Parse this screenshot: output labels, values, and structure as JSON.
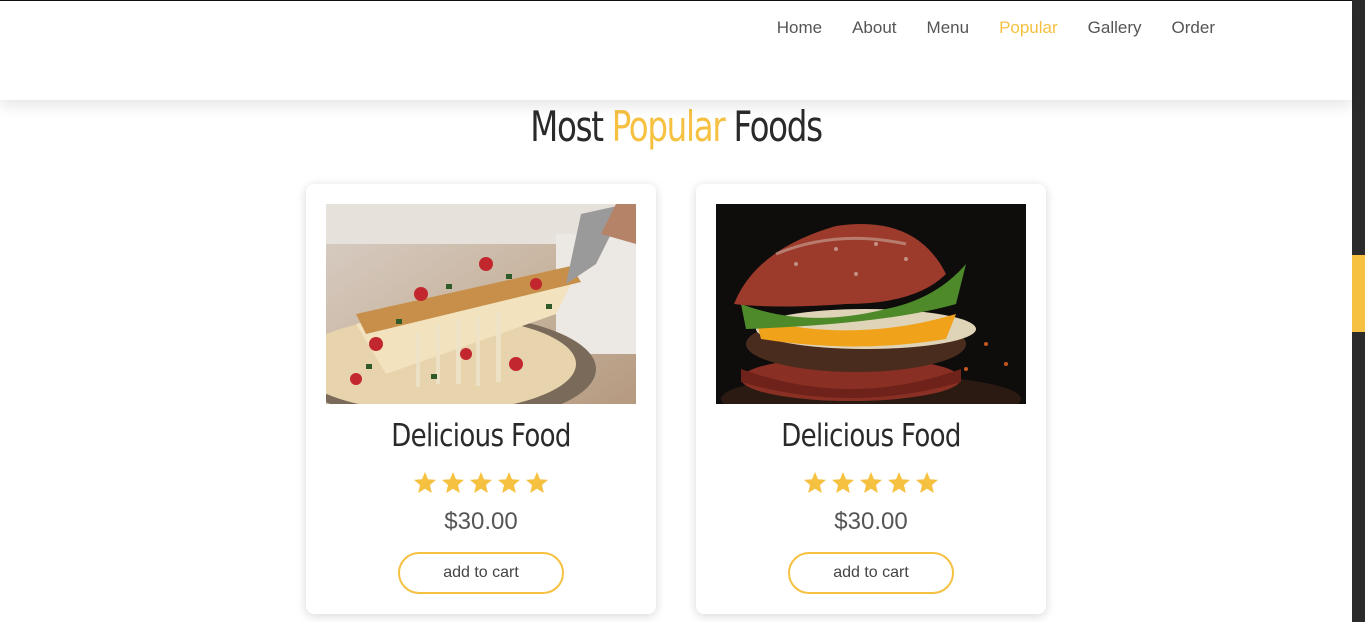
{
  "nav": {
    "items": [
      {
        "label": "Home"
      },
      {
        "label": "About"
      },
      {
        "label": "Menu"
      },
      {
        "label": "Popular"
      },
      {
        "label": "Gallery"
      },
      {
        "label": "Order"
      }
    ],
    "active": "Popular"
  },
  "section": {
    "title_before": "Most",
    "title_accent": "Popular",
    "title_after": "Foods"
  },
  "cards": [
    {
      "name": "Delicious Food",
      "image": "pizza-slice-photo",
      "rating": 5,
      "price": "$30.00",
      "button": "add to cart"
    },
    {
      "name": "Delicious Food",
      "image": "burger-photo",
      "rating": 5,
      "price": "$30.00",
      "button": "add to cart"
    }
  ],
  "colors": {
    "accent": "#f6c141",
    "text_dark": "#2a2a2a",
    "text_muted": "#555555",
    "scrollbar_track": "#2b2b2b"
  }
}
